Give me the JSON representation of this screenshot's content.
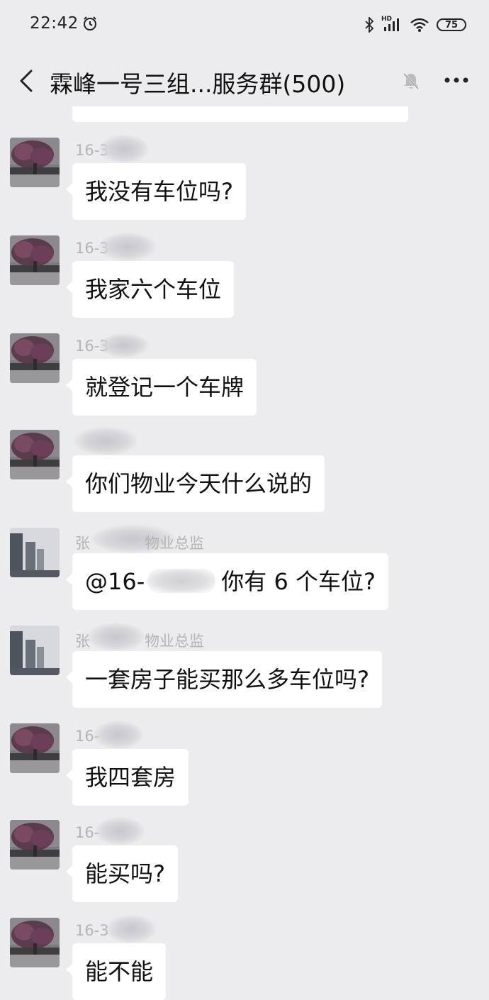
{
  "status_bar": {
    "time": "22:42",
    "network_label": "HD",
    "battery": "75"
  },
  "header": {
    "title": "霖峰一号三组...服务群(500)"
  },
  "messages": [
    {
      "sender": "16-3",
      "text": "我没有车位吗?",
      "avatar": "tree-avatar"
    },
    {
      "sender": "16-3",
      "text": "我家六个车位",
      "avatar": "tree-avatar"
    },
    {
      "sender": "16-3",
      "text": "就登记一个车牌",
      "avatar": "tree-avatar"
    },
    {
      "sender": "",
      "text": "你们物业今天什么说的",
      "avatar": "tree-avatar"
    },
    {
      "sender": "张",
      "sender_role": "物业总监",
      "text_prefix": "@16-",
      "text": "你有 6 个车位?",
      "avatar": "building-avatar"
    },
    {
      "sender": "张",
      "sender_role": "物业总监",
      "text": "一套房子能买那么多车位吗?",
      "avatar": "building-avatar"
    },
    {
      "sender": "16-",
      "text": "我四套房",
      "avatar": "tree-avatar"
    },
    {
      "sender": "16-",
      "text": "能买吗?",
      "avatar": "tree-avatar"
    },
    {
      "sender": "16-3",
      "text": "能不能",
      "avatar": "tree-avatar"
    }
  ],
  "colors": {
    "background": "#ececef",
    "bubble": "#ffffff",
    "sender_text": "#b4b4b8"
  }
}
